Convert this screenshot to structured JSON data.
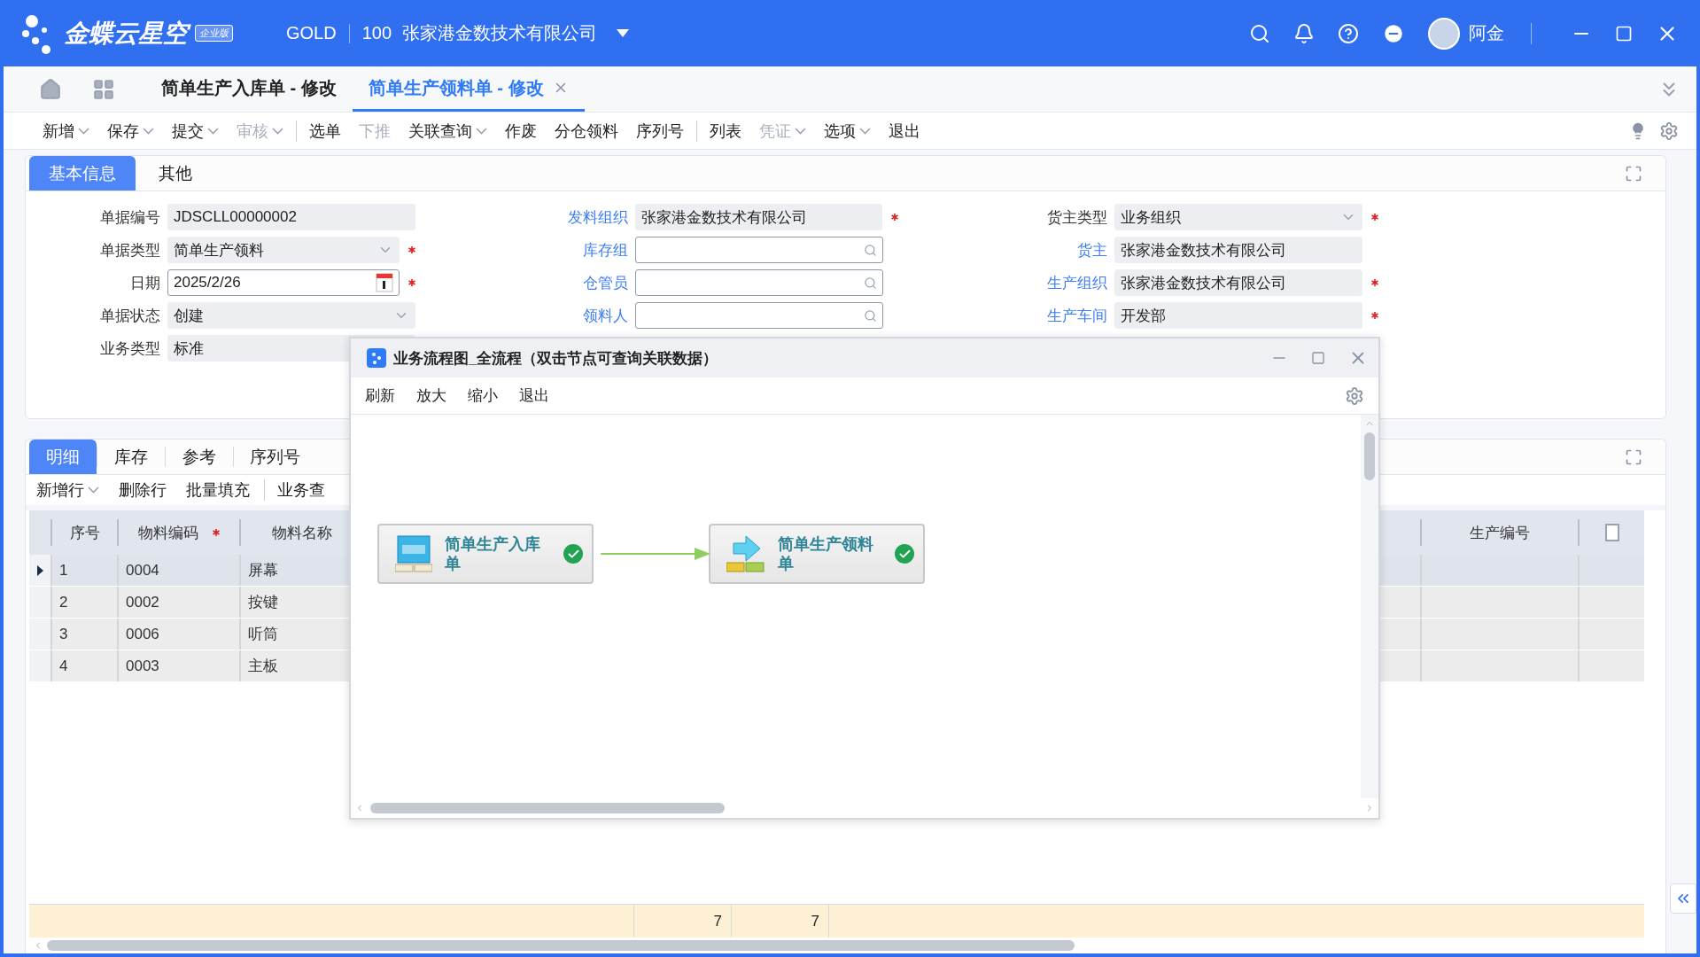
{
  "app": {
    "brand": "金蝶云星空",
    "edition": "企业版",
    "account": "GOLD",
    "org_code": "100",
    "org_name": "张家港金数技术有限公司",
    "user": "阿金"
  },
  "page_tabs": [
    {
      "label": "简单生产入库单 - 修改",
      "selected": false,
      "closable": false
    },
    {
      "label": "简单生产领料单 - 修改",
      "selected": true,
      "closable": true
    }
  ],
  "toolbar": [
    [
      {
        "label": "新增",
        "dropdown": true,
        "disabled": false
      },
      {
        "label": "保存",
        "dropdown": true,
        "disabled": false
      },
      {
        "label": "提交",
        "dropdown": true,
        "disabled": false
      },
      {
        "label": "审核",
        "dropdown": true,
        "disabled": true
      }
    ],
    [
      {
        "label": "选单",
        "dropdown": false,
        "disabled": false
      },
      {
        "label": "下推",
        "dropdown": false,
        "disabled": true
      },
      {
        "label": "关联查询",
        "dropdown": true,
        "disabled": false
      },
      {
        "label": "作废",
        "dropdown": false,
        "disabled": false
      },
      {
        "label": "分仓领料",
        "dropdown": false,
        "disabled": false
      },
      {
        "label": "序列号",
        "dropdown": false,
        "disabled": false
      }
    ],
    [
      {
        "label": "列表",
        "dropdown": false,
        "disabled": false
      },
      {
        "label": "凭证",
        "dropdown": true,
        "disabled": true
      },
      {
        "label": "选项",
        "dropdown": true,
        "disabled": false
      },
      {
        "label": "退出",
        "dropdown": false,
        "disabled": false
      }
    ]
  ],
  "form": {
    "tabs": [
      {
        "label": "基本信息",
        "selected": true
      },
      {
        "label": "其他",
        "selected": false
      }
    ],
    "columns": [
      [
        {
          "label": "单据编号",
          "value": "JDSCLL00000002",
          "kind": "text",
          "linked": false,
          "required": false
        },
        {
          "label": "单据类型",
          "value": "简单生产领料",
          "kind": "select",
          "linked": false,
          "required": true
        },
        {
          "label": "日期",
          "value": "2025/2/26",
          "kind": "date",
          "linked": false,
          "required": true
        },
        {
          "label": "单据状态",
          "value": "创建",
          "kind": "select",
          "linked": false,
          "required": false
        },
        {
          "label": "业务类型",
          "value": "标准",
          "kind": "text",
          "linked": false,
          "required": false
        }
      ],
      [
        {
          "label": "发料组织",
          "value": "张家港金数技术有限公司",
          "kind": "text",
          "linked": true,
          "required": true
        },
        {
          "label": "库存组",
          "kind": "search",
          "linked": true,
          "required": false
        },
        {
          "label": "仓管员",
          "kind": "search",
          "linked": true,
          "required": false
        },
        {
          "label": "领料人",
          "kind": "search",
          "linked": true,
          "required": false
        }
      ],
      [
        {
          "label": "货主类型",
          "value": "业务组织",
          "kind": "select",
          "linked": false,
          "required": true
        },
        {
          "label": "货主",
          "value": "张家港金数技术有限公司",
          "kind": "text",
          "linked": true,
          "required": false
        },
        {
          "label": "生产组织",
          "value": "张家港金数技术有限公司",
          "kind": "text",
          "linked": true,
          "required": true
        },
        {
          "label": "生产车间",
          "value": "开发部",
          "kind": "text",
          "linked": true,
          "required": true
        }
      ]
    ]
  },
  "detail": {
    "tabs": [
      {
        "label": "明细",
        "selected": true
      },
      {
        "label": "库存",
        "selected": false
      },
      {
        "label": "参考",
        "selected": false
      },
      {
        "label": "序列号",
        "selected": false
      }
    ],
    "toolbar": [
      [
        {
          "label": "新增行",
          "dropdown": true
        },
        {
          "label": "删除行",
          "dropdown": false
        },
        {
          "label": "批量填充",
          "dropdown": false
        }
      ],
      [
        {
          "label": "业务查",
          "dropdown": false
        }
      ]
    ],
    "table": {
      "columns": [
        {
          "label": "序号",
          "required": false
        },
        {
          "label": "物料编码",
          "required": true
        },
        {
          "label": "物料名称",
          "required": false
        },
        {
          "label": "生产编号",
          "required": false
        }
      ],
      "select_all_checked": false,
      "rows": [
        {
          "cells": [
            "1",
            "0004",
            "屏幕"
          ],
          "selected": true
        },
        {
          "cells": [
            "2",
            "0002",
            "按键"
          ],
          "selected": false
        },
        {
          "cells": [
            "3",
            "0006",
            "听筒"
          ],
          "selected": false
        },
        {
          "cells": [
            "4",
            "0003",
            "主板"
          ],
          "selected": false
        }
      ],
      "totals": [
        "7",
        "7"
      ]
    }
  },
  "dialog": {
    "title": "业务流程图_全流程（双击节点可查询关联数据）",
    "toolbar": [
      "刷新",
      "放大",
      "缩小",
      "退出"
    ],
    "nodes": [
      {
        "label": "简单生产入库单",
        "kind": "inbound",
        "done": true
      },
      {
        "label": "简单生产领料单",
        "kind": "issue",
        "done": true
      }
    ]
  }
}
